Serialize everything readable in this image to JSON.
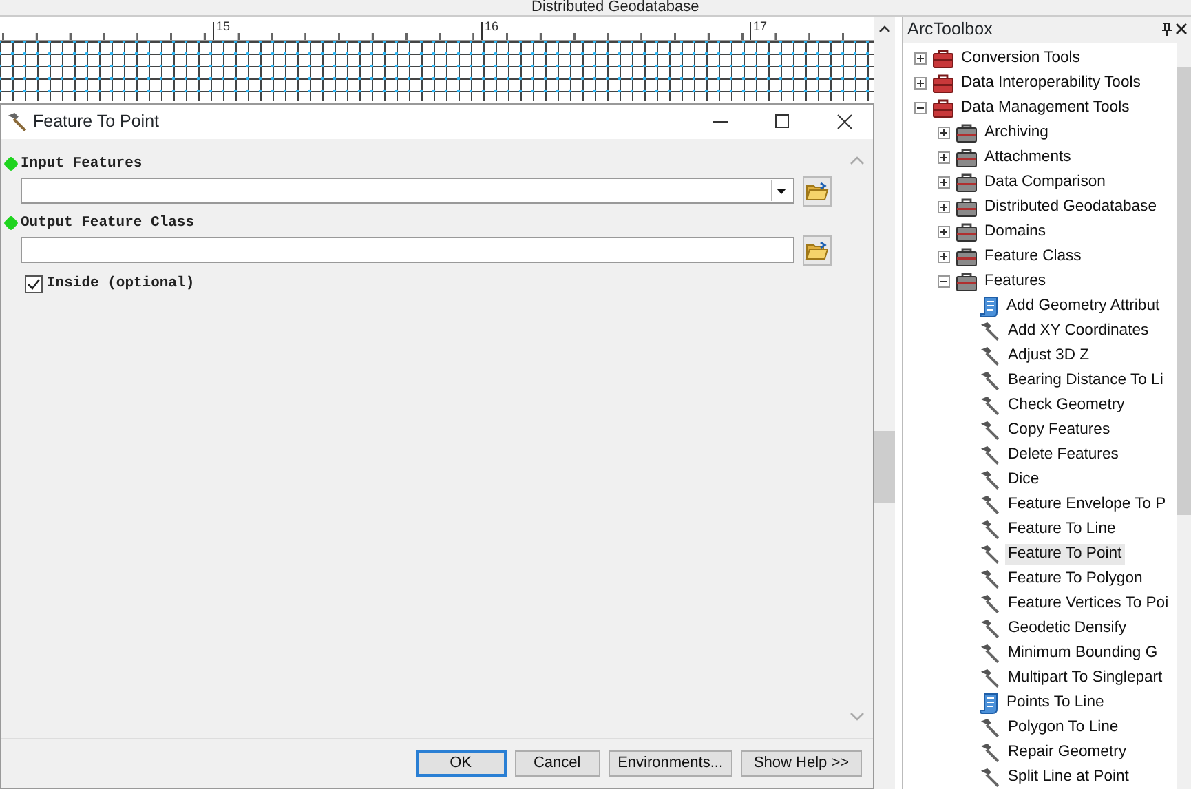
{
  "toolbar": {
    "text": "Distributed Geodatabase"
  },
  "ruler": {
    "labels": [
      "15",
      "16",
      "17"
    ]
  },
  "dialog": {
    "title": "Feature To Point",
    "parameters": [
      {
        "kind": "dropdown",
        "label": "Input Features",
        "required": true
      },
      {
        "kind": "text",
        "label": "Output Feature Class",
        "required": true
      },
      {
        "kind": "checkbox",
        "label": "Inside (optional)",
        "checked": true
      }
    ],
    "buttons": [
      {
        "label": "OK",
        "default": true
      },
      {
        "label": "Cancel",
        "default": false
      },
      {
        "label": "Environments...",
        "default": false
      },
      {
        "label": "Show Help >>",
        "default": false
      }
    ]
  },
  "toolbox": {
    "title": "ArcToolbox",
    "tree": [
      {
        "kind": "toolbox",
        "label": "Conversion Tools",
        "expanded": false,
        "selected": false
      },
      {
        "kind": "toolbox",
        "label": "Data Interoperability Tools",
        "expanded": false,
        "selected": false
      },
      {
        "kind": "toolbox",
        "label": "Data Management Tools",
        "expanded": true,
        "selected": false,
        "children": [
          {
            "kind": "toolset",
            "label": "Archiving",
            "expanded": false,
            "selected": false
          },
          {
            "kind": "toolset",
            "label": "Attachments",
            "expanded": false,
            "selected": false
          },
          {
            "kind": "toolset",
            "label": "Data Comparison",
            "expanded": false,
            "selected": false
          },
          {
            "kind": "toolset",
            "label": "Distributed Geodatabase",
            "expanded": false,
            "selected": false
          },
          {
            "kind": "toolset",
            "label": "Domains",
            "expanded": false,
            "selected": false
          },
          {
            "kind": "toolset",
            "label": "Feature Class",
            "expanded": false,
            "selected": false
          },
          {
            "kind": "toolset",
            "label": "Features",
            "expanded": true,
            "selected": false,
            "children": [
              {
                "kind": "script",
                "label": "Add Geometry Attribut",
                "selected": false
              },
              {
                "kind": "tool",
                "label": "Add XY Coordinates",
                "selected": false
              },
              {
                "kind": "tool",
                "label": "Adjust 3D Z",
                "selected": false
              },
              {
                "kind": "tool",
                "label": "Bearing Distance To Li",
                "selected": false
              },
              {
                "kind": "tool",
                "label": "Check Geometry",
                "selected": false
              },
              {
                "kind": "tool",
                "label": "Copy Features",
                "selected": false
              },
              {
                "kind": "tool",
                "label": "Delete Features",
                "selected": false
              },
              {
                "kind": "tool",
                "label": "Dice",
                "selected": false
              },
              {
                "kind": "tool",
                "label": "Feature Envelope To P",
                "selected": false
              },
              {
                "kind": "tool",
                "label": "Feature To Line",
                "selected": false
              },
              {
                "kind": "tool",
                "label": "Feature To Point",
                "selected": true
              },
              {
                "kind": "tool",
                "label": "Feature To Polygon",
                "selected": false
              },
              {
                "kind": "tool",
                "label": "Feature Vertices To Poi",
                "selected": false
              },
              {
                "kind": "tool",
                "label": "Geodetic Densify",
                "selected": false
              },
              {
                "kind": "tool",
                "label": "Minimum Bounding G",
                "selected": false
              },
              {
                "kind": "tool",
                "label": "Multipart To Singlepart",
                "selected": false
              },
              {
                "kind": "script",
                "label": "Points To Line",
                "selected": false
              },
              {
                "kind": "tool",
                "label": "Polygon To Line",
                "selected": false
              },
              {
                "kind": "tool",
                "label": "Repair Geometry",
                "selected": false
              },
              {
                "kind": "tool",
                "label": "Split Line at Point",
                "selected": false
              }
            ]
          }
        ]
      }
    ]
  }
}
